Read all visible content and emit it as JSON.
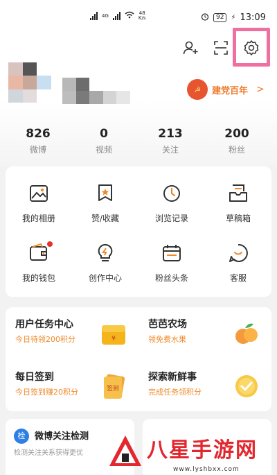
{
  "status_bar": {
    "network_label": "4G",
    "speed_value": "48",
    "speed_unit": "K/s",
    "battery": "92",
    "time": "13:09"
  },
  "header": {
    "icons": [
      "add-user-icon",
      "scan-icon",
      "settings-icon"
    ],
    "highlight_color": "#ef6fa0"
  },
  "profile": {
    "badge_text": "建党百年",
    "badge_arrow": ">"
  },
  "stats": [
    {
      "value": "826",
      "label": "微博"
    },
    {
      "value": "0",
      "label": "视频"
    },
    {
      "value": "213",
      "label": "关注"
    },
    {
      "value": "200",
      "label": "粉丝"
    }
  ],
  "grid": [
    {
      "label": "我的相册",
      "icon": "album-icon"
    },
    {
      "label": "赞/收藏",
      "icon": "favorite-icon"
    },
    {
      "label": "浏览记录",
      "icon": "history-icon"
    },
    {
      "label": "草稿箱",
      "icon": "drafts-icon"
    },
    {
      "label": "我的钱包",
      "icon": "wallet-icon"
    },
    {
      "label": "创作中心",
      "icon": "creator-icon"
    },
    {
      "label": "粉丝头条",
      "icon": "headline-icon"
    },
    {
      "label": "客服",
      "icon": "service-icon"
    }
  ],
  "tasks": [
    {
      "title": "用户任务中心",
      "sub": "今日待领200积分"
    },
    {
      "title": "芭芭农场",
      "sub": "领免费水果"
    },
    {
      "title": "每日签到",
      "sub": "今日签到赚20积分"
    },
    {
      "title": "探索新鲜事",
      "sub": "完成任务领积分"
    }
  ],
  "task_images": {
    "checkin_text": "签到"
  },
  "bottom": {
    "card1_title": "微博关注检测",
    "card1_sub": "检测关注关系获得更优",
    "card1_icon": "检"
  },
  "watermark": {
    "text": "八星手游网",
    "url": "www.lyshbxx.com"
  },
  "colors": {
    "accent_orange": "#ef8a2a",
    "badge_red": "#e5332a",
    "watermark_red": "#e2272e"
  }
}
